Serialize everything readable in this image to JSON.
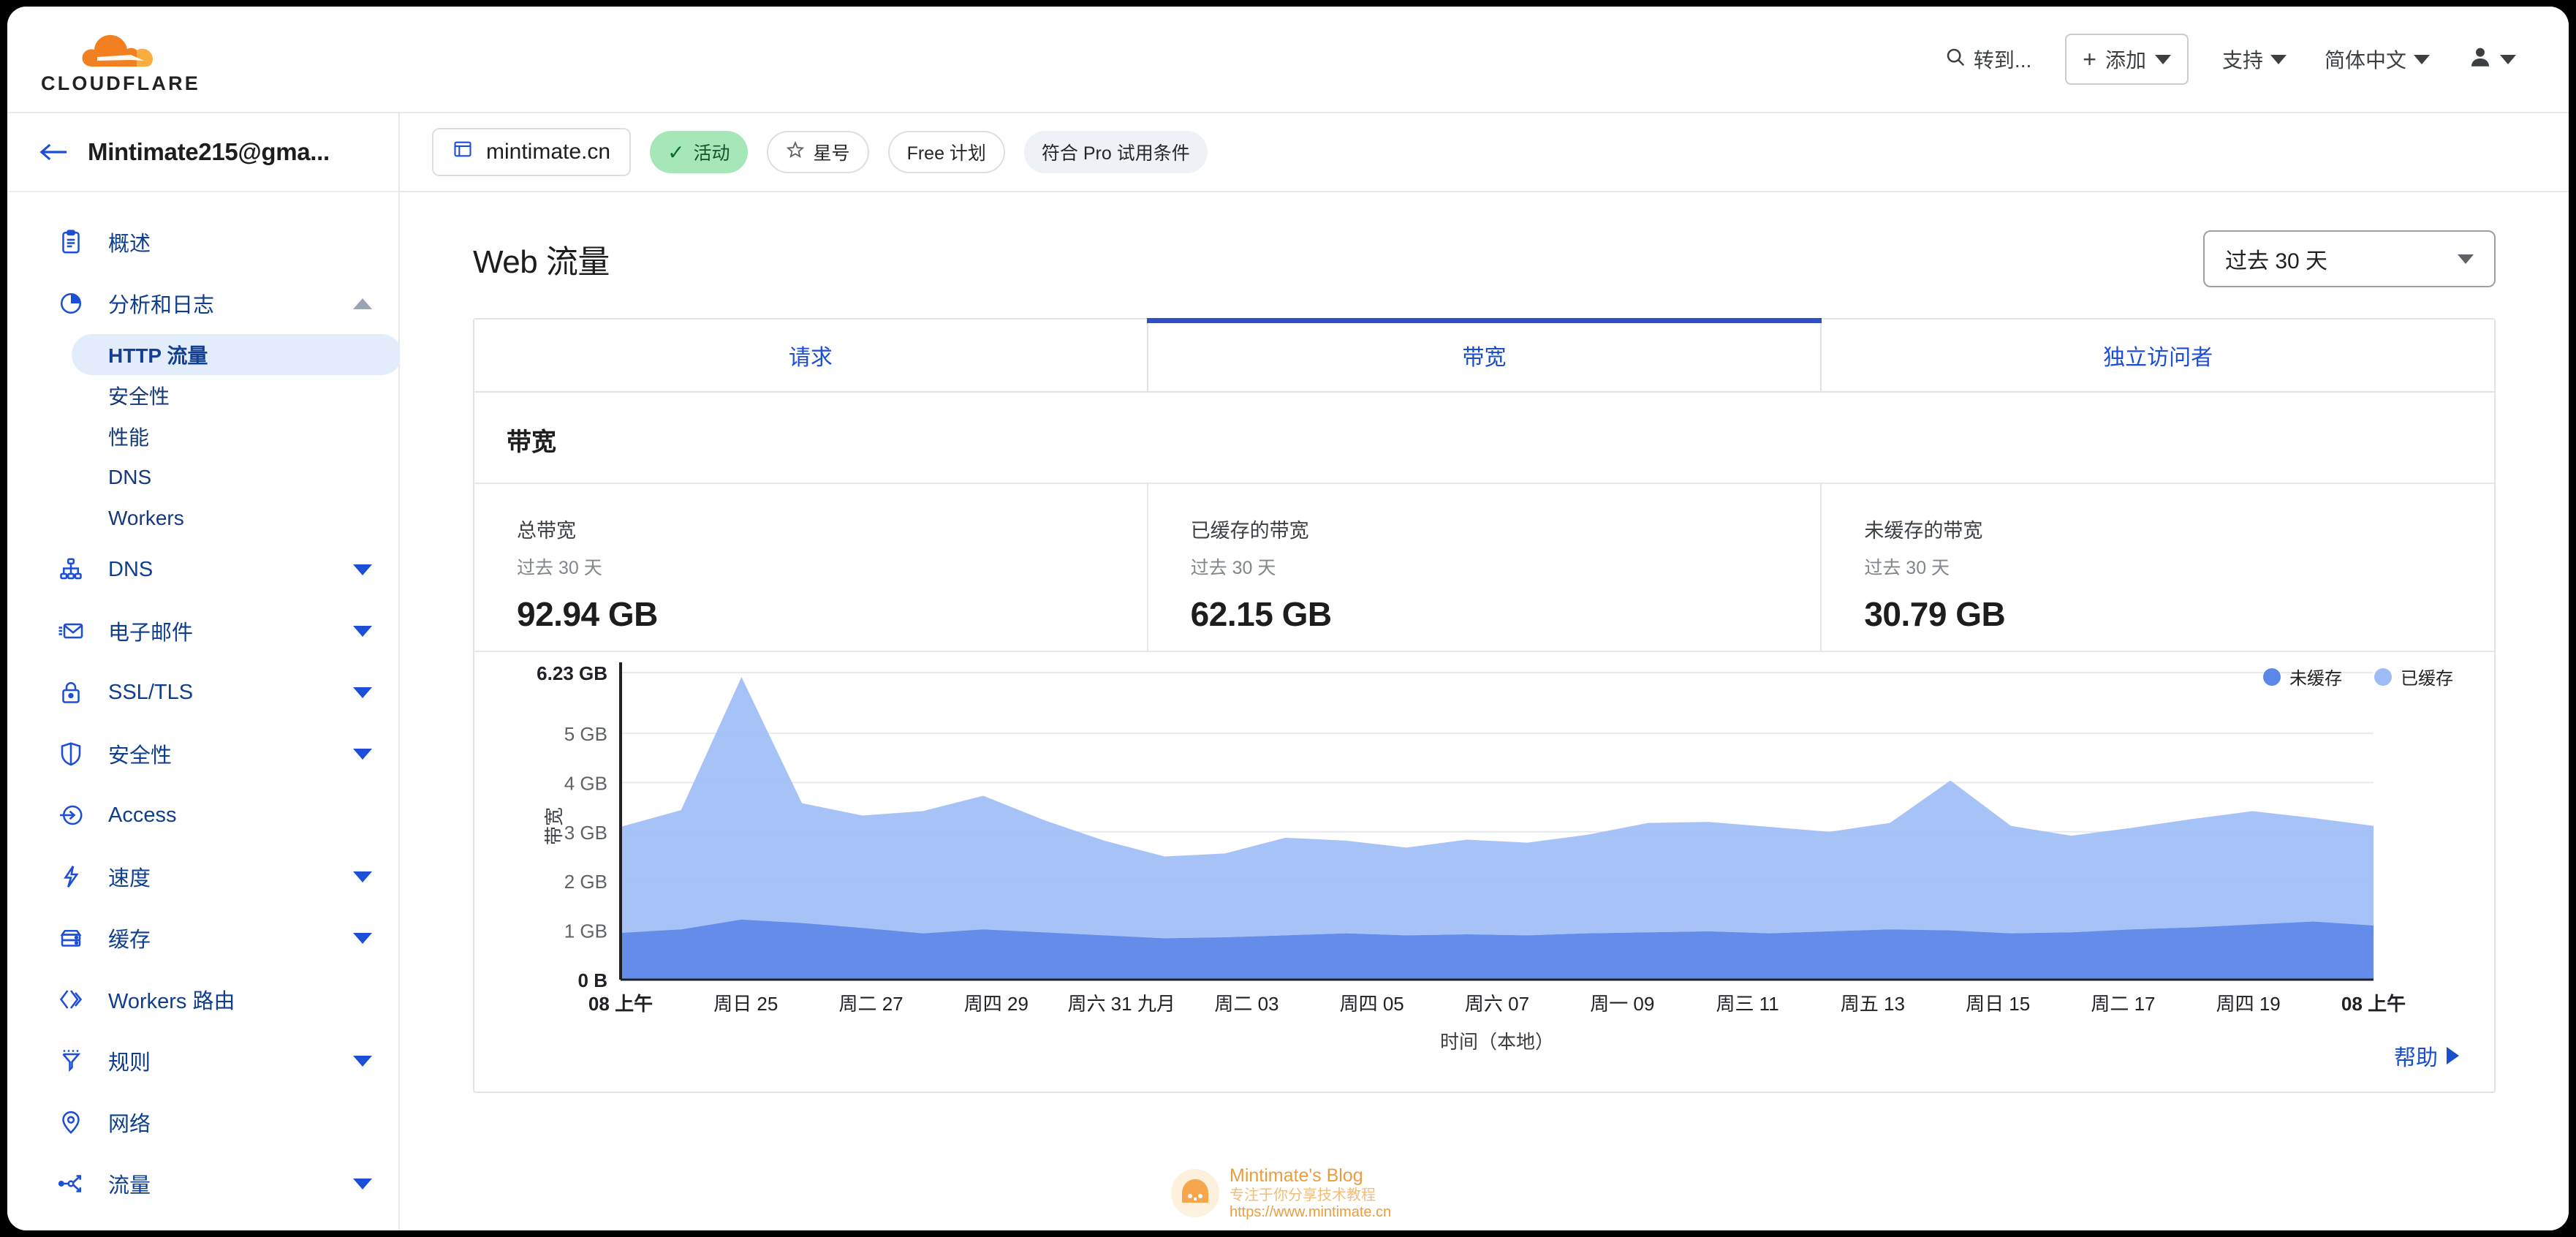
{
  "topbar": {
    "logo_text": "CLOUDFLARE",
    "search_label": "转到...",
    "add_label": "添加",
    "support_label": "支持",
    "language_label": "简体中文"
  },
  "sidebar": {
    "account_name": "Mintimate215@gma...",
    "items": [
      {
        "label": "概述",
        "icon": "clipboard-icon",
        "expandable": false
      },
      {
        "label": "分析和日志",
        "icon": "pie-chart-icon",
        "expandable": true,
        "expanded": true
      },
      {
        "label": "DNS",
        "icon": "dns-tree-icon",
        "expandable": true
      },
      {
        "label": "电子邮件",
        "icon": "envelope-icon",
        "expandable": true
      },
      {
        "label": "SSL/TLS",
        "icon": "lock-icon",
        "expandable": true
      },
      {
        "label": "安全性",
        "icon": "shield-icon",
        "expandable": true
      },
      {
        "label": "Access",
        "icon": "access-arrow-icon",
        "expandable": false
      },
      {
        "label": "速度",
        "icon": "bolt-icon",
        "expandable": true
      },
      {
        "label": "缓存",
        "icon": "server-icon",
        "expandable": true
      },
      {
        "label": "Workers 路由",
        "icon": "code-brackets-icon",
        "expandable": false
      },
      {
        "label": "规则",
        "icon": "funnel-icon",
        "expandable": true
      },
      {
        "label": "网络",
        "icon": "map-pin-icon",
        "expandable": false
      },
      {
        "label": "流量",
        "icon": "traffic-nodes-icon",
        "expandable": true
      }
    ],
    "sub_items": [
      {
        "label": "HTTP 流量",
        "active": true
      },
      {
        "label": "安全性",
        "active": false
      },
      {
        "label": "性能",
        "active": false
      },
      {
        "label": "DNS",
        "active": false
      },
      {
        "label": "Workers",
        "active": false
      }
    ]
  },
  "zonebar": {
    "domain": "mintimate.cn",
    "badges": [
      {
        "text": "活动",
        "style": "green",
        "icon": "check-icon"
      },
      {
        "text": "星号",
        "style": "outline",
        "icon": "star-icon"
      },
      {
        "text": "Free 计划",
        "style": "outline",
        "icon": ""
      },
      {
        "text": "符合 Pro 试用条件",
        "style": "grey",
        "icon": ""
      }
    ]
  },
  "page": {
    "title": "Web 流量",
    "range_value": "过去 30 天",
    "help_label": "帮助"
  },
  "tabs": [
    {
      "label": "请求",
      "active": false
    },
    {
      "label": "带宽",
      "active": true
    },
    {
      "label": "独立访问者",
      "active": false
    }
  ],
  "section": {
    "title": "带宽",
    "stats": [
      {
        "label": "总带宽",
        "sub": "过去 30 天",
        "value": "92.94 GB"
      },
      {
        "label": "已缓存的带宽",
        "sub": "过去 30 天",
        "value": "62.15 GB"
      },
      {
        "label": "未缓存的带宽",
        "sub": "过去 30 天",
        "value": "30.79 GB"
      }
    ]
  },
  "colors": {
    "uncached": "#5b87e8",
    "cached": "#9ebdf6",
    "accent": "#1a4fcb",
    "brand_orange": "#f6821f"
  },
  "watermark": {
    "title": "Mintimate's Blog",
    "subtitle": "专注于你分享技术教程",
    "url": "https://www.mintimate.cn"
  },
  "chart_data": {
    "type": "area",
    "title": "带宽",
    "xlabel": "时间（本地）",
    "ylabel": "带宽",
    "stacked": true,
    "grid": true,
    "legend_position": "top-right",
    "ylim": [
      0,
      6.23
    ],
    "yticks": [
      0,
      1,
      2,
      3,
      4,
      5,
      6.23
    ],
    "ytick_labels": [
      "0 B",
      "1 GB",
      "2 GB",
      "3 GB",
      "4 GB",
      "5 GB",
      "6.23 GB"
    ],
    "xtick_labels": [
      "08 上午",
      "周日 25",
      "周二 27",
      "周四 29",
      "周六 31 九月",
      "周二 03",
      "周四 05",
      "周六 07",
      "周一 09",
      "周三 11",
      "周五 13",
      "周日 15",
      "周二 17",
      "周四 19",
      "08 上午"
    ],
    "x": [
      0,
      1,
      2,
      3,
      4,
      5,
      6,
      7,
      8,
      9,
      10,
      11,
      12,
      13,
      14,
      15,
      16,
      17,
      18,
      19,
      20,
      21,
      22,
      23,
      24,
      25,
      26,
      27,
      28,
      29
    ],
    "series": [
      {
        "name": "未缓存",
        "color": "#5b87e8",
        "values": [
          0.95,
          1.02,
          1.22,
          1.15,
          1.05,
          0.94,
          1.02,
          0.96,
          0.9,
          0.84,
          0.86,
          0.9,
          0.94,
          0.9,
          0.92,
          0.9,
          0.94,
          0.96,
          0.98,
          0.94,
          0.98,
          1.02,
          1.0,
          0.94,
          0.96,
          1.02,
          1.06,
          1.12,
          1.18,
          1.1
        ]
      },
      {
        "name": "已缓存",
        "color": "#9ebdf6",
        "values": [
          2.15,
          2.42,
          4.92,
          2.43,
          2.28,
          2.48,
          2.71,
          2.28,
          1.92,
          1.66,
          1.7,
          1.98,
          1.88,
          1.78,
          1.92,
          1.88,
          2.0,
          2.22,
          2.22,
          2.16,
          2.02,
          2.16,
          3.04,
          2.18,
          1.96,
          2.06,
          2.2,
          2.3,
          2.1,
          2.02
        ]
      }
    ],
    "totals": [
      3.1,
      3.44,
      6.14,
      3.58,
      3.33,
      3.42,
      3.73,
      3.24,
      2.82,
      2.5,
      2.56,
      2.88,
      2.82,
      2.68,
      2.84,
      2.78,
      2.94,
      3.18,
      3.2,
      3.1,
      3.0,
      3.18,
      4.04,
      3.12,
      2.92,
      3.08,
      3.26,
      3.42,
      3.28,
      3.12
    ]
  }
}
